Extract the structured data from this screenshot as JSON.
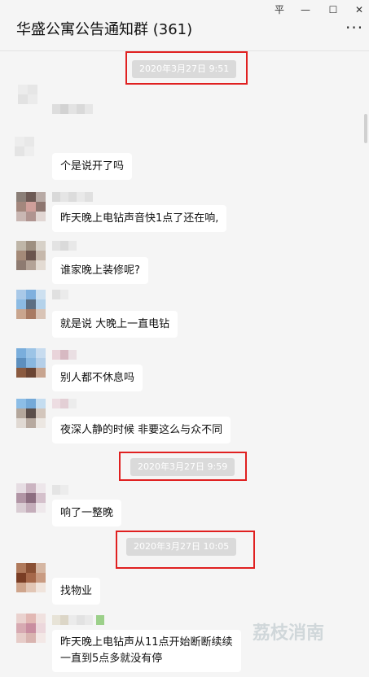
{
  "window": {
    "title": "华盛公寓公告通知群 (361)",
    "buttons": {
      "pin": "平",
      "minimize": "—",
      "maximize": "☐",
      "close": "✕"
    },
    "more": "···"
  },
  "timestamps": [
    "2020年3月27日 9:51",
    "2020年3月27日 9:59",
    "2020年3月27日 10:05"
  ],
  "messages": [
    "个是说开了吗",
    "昨天晚上电钻声音快1点了还在响,",
    "谁家晚上装修呢?",
    "就是说 大晚上一直电钻",
    "别人都不休息吗",
    "夜深人静的时候 非要这么与众不同",
    "响了一整晚",
    "找物业",
    "昨天晚上电钻声从11点开始断断续续",
    "一直到5点多就没有停"
  ],
  "watermark": "荔枝消南",
  "colors": {
    "accent_box": "#e02020",
    "background": "#f5f5f5",
    "bubble": "#ffffff",
    "timestamp_bg": "#dadada"
  }
}
